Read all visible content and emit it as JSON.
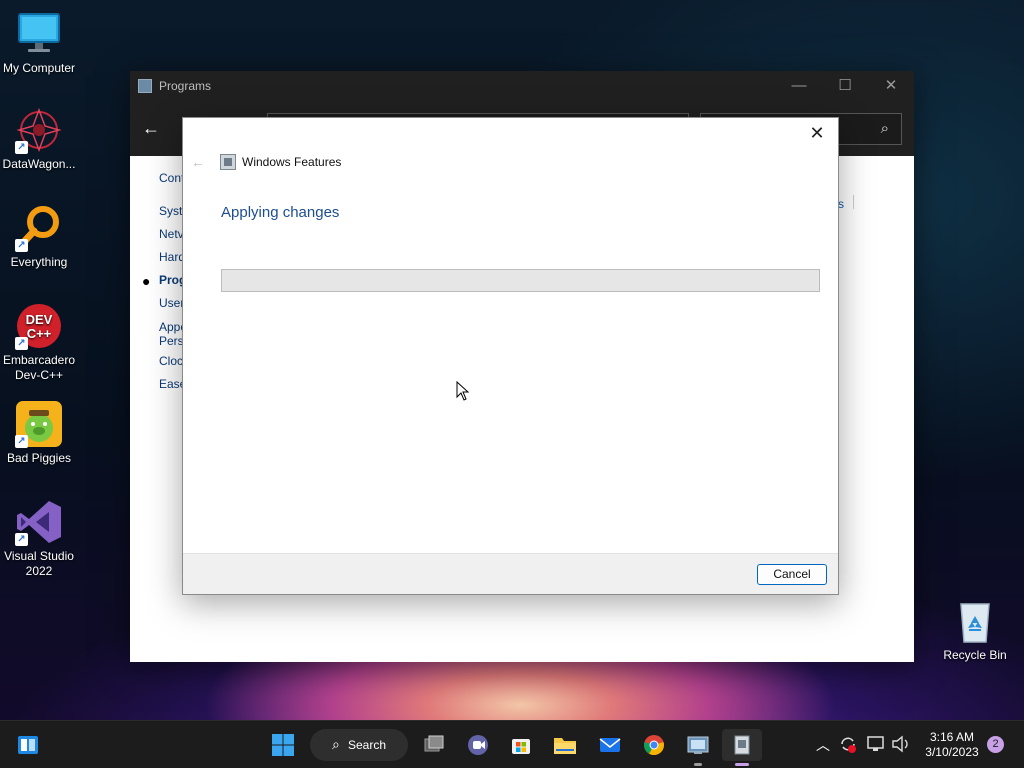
{
  "desktop": {
    "icons": [
      {
        "label": "My Computer"
      },
      {
        "label": "DataWagon..."
      },
      {
        "label": "Everything"
      },
      {
        "label": "Embarcadero Dev-C++"
      },
      {
        "label": "Bad Piggies"
      },
      {
        "label": "Visual Studio 2022"
      }
    ],
    "recycle_bin": {
      "label": "Recycle Bin"
    }
  },
  "programs_window": {
    "title": "Programs",
    "sidebar": {
      "items": [
        "Cont",
        "Syste",
        "Netv",
        "Hard",
        "Prog",
        "User",
        "Appe",
        "Perse",
        "Clock",
        "Ease"
      ]
    },
    "right_fragment": "s"
  },
  "dialog": {
    "title": "Windows Features",
    "heading": "Applying changes",
    "progress": 0,
    "cancel_label": "Cancel"
  },
  "taskbar": {
    "search_label": "Search",
    "time": "3:16 AM",
    "date": "3/10/2023",
    "notification_count": "2"
  }
}
